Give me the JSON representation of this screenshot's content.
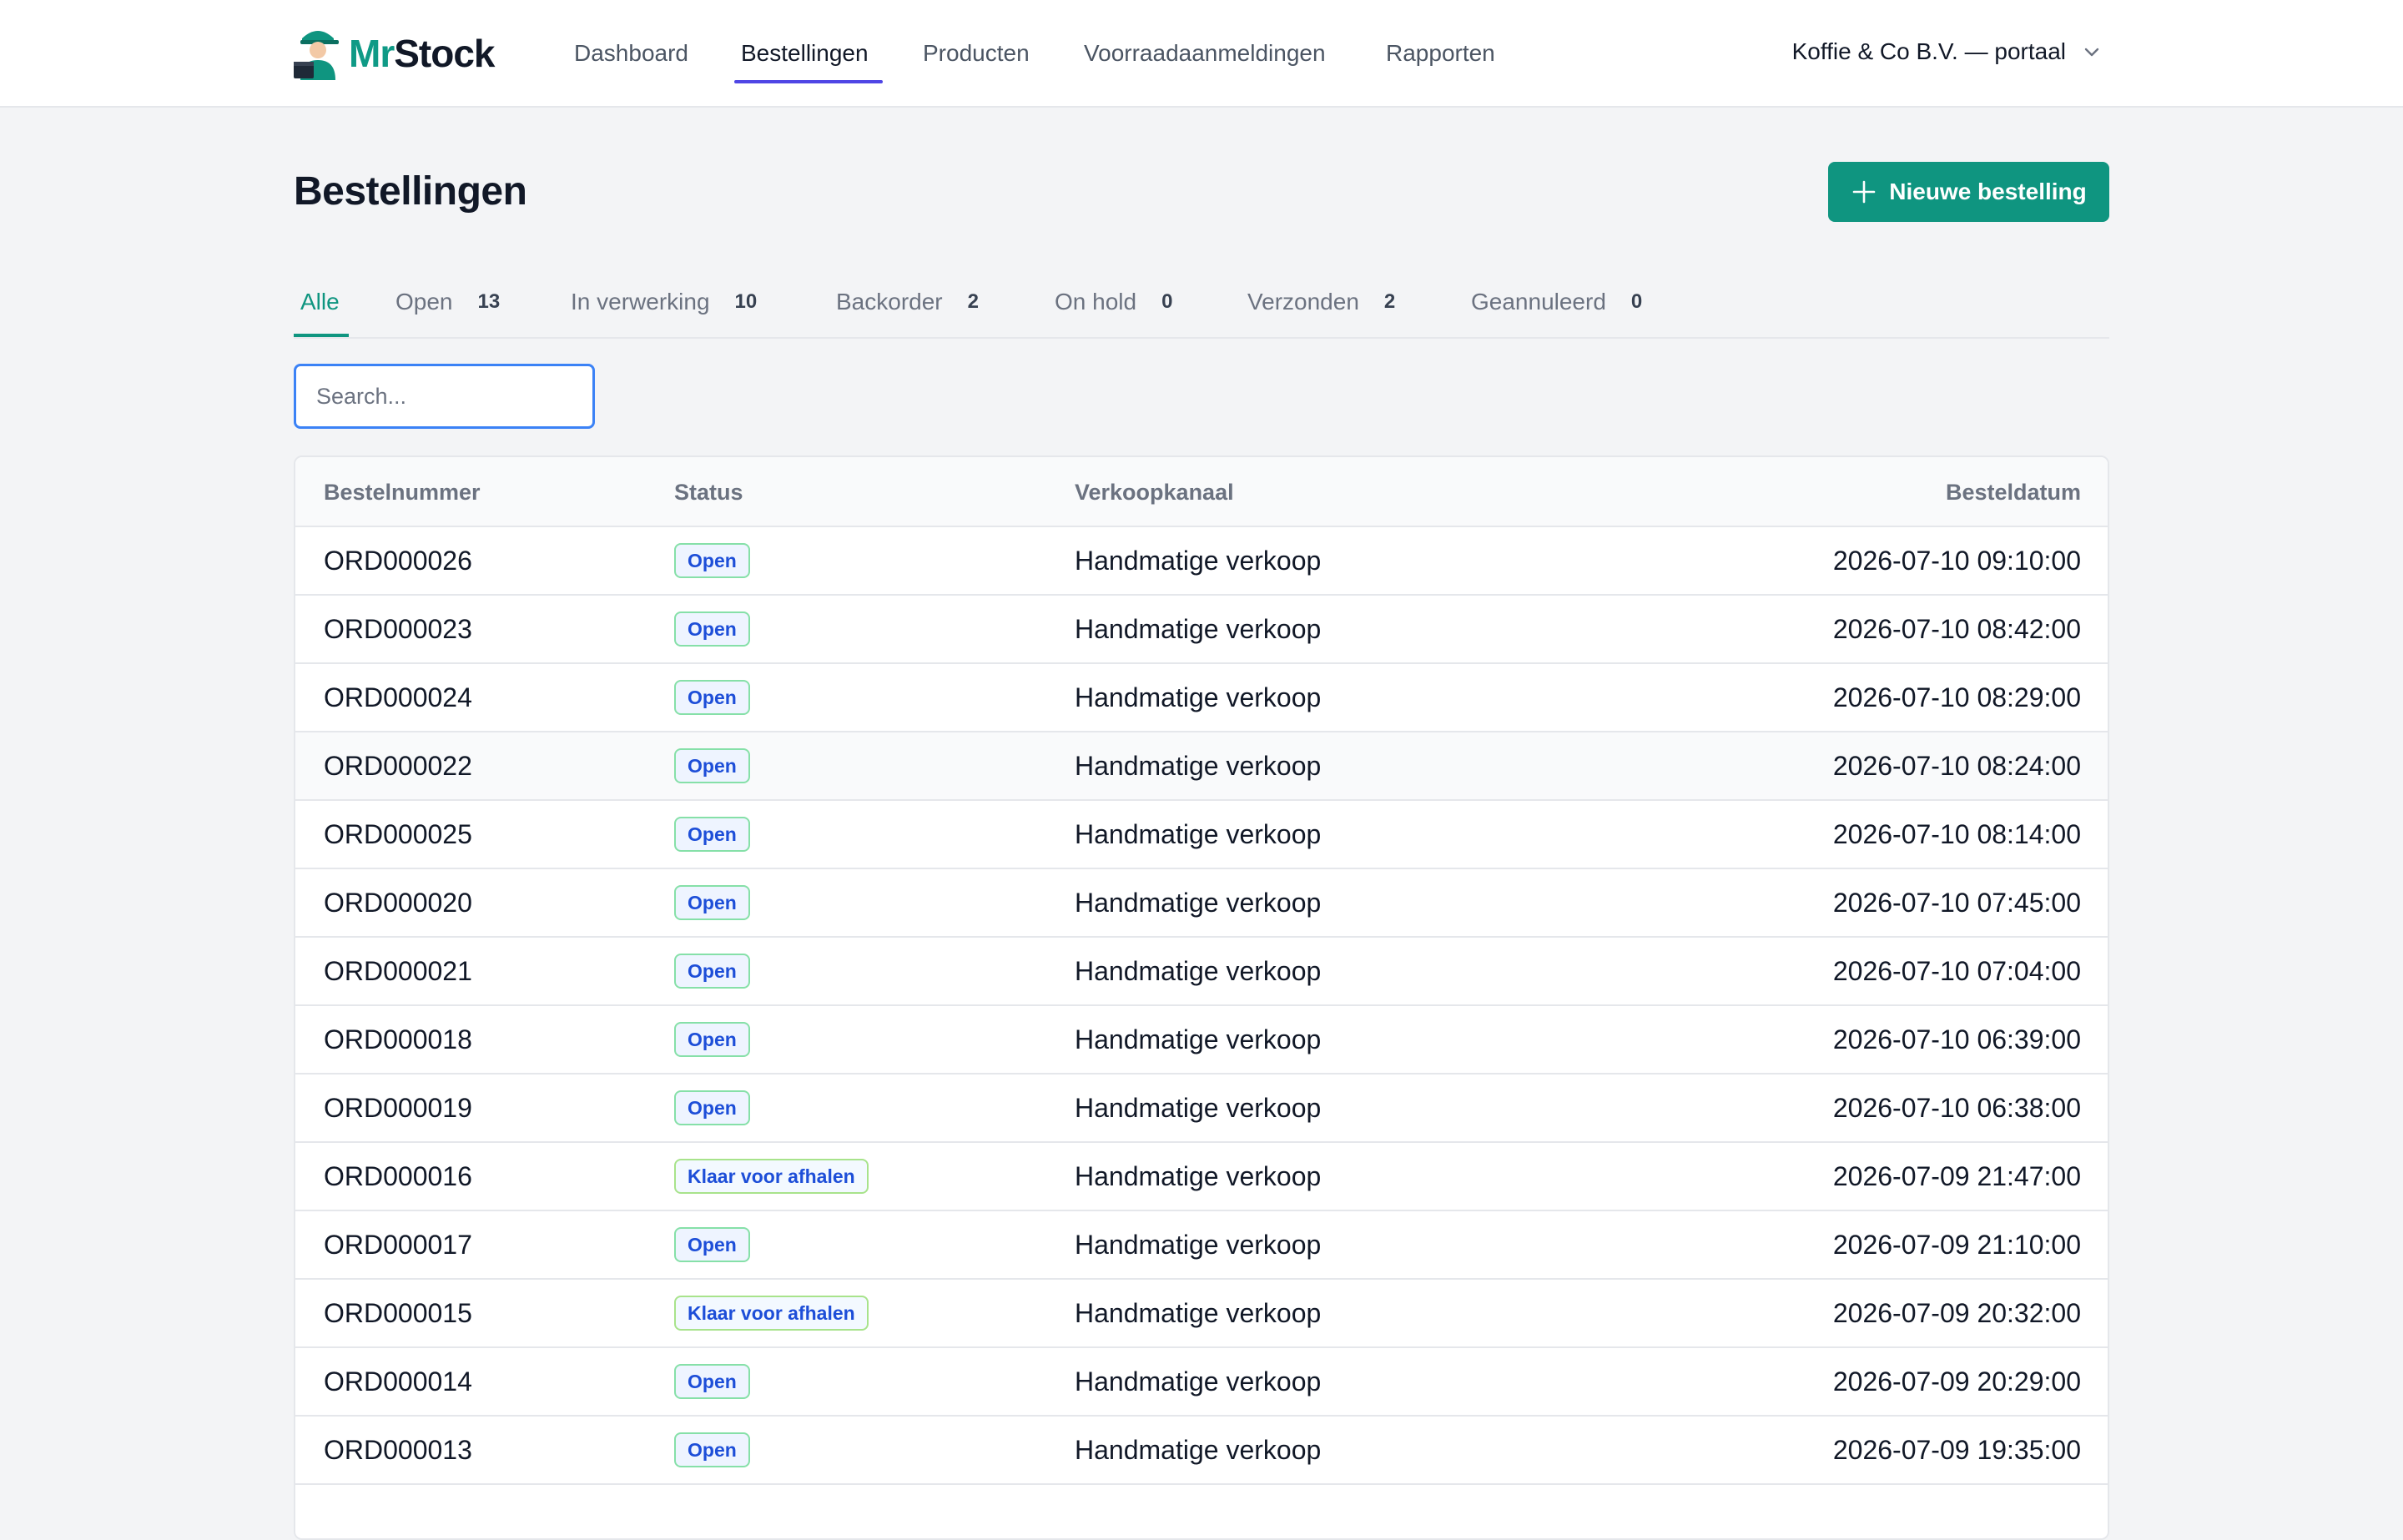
{
  "brand": {
    "mr": "Mr",
    "stock": "Stock",
    "mascot_icon": "delivery-person-icon"
  },
  "nav": [
    {
      "label": "Dashboard"
    },
    {
      "label": "Bestellingen"
    },
    {
      "label": "Producten"
    },
    {
      "label": "Voorraadaanmeldingen"
    },
    {
      "label": "Rapporten"
    }
  ],
  "nav_active": "Bestellingen",
  "account": {
    "label": "Koffie & Co B.V. — portaal",
    "icon": "chevron-down-icon"
  },
  "page": {
    "title": "Bestellingen",
    "new_button": "Nieuwe bestelling",
    "new_button_icon": "plus-icon",
    "accent_color": "#0f9580"
  },
  "tabs": [
    {
      "label": "Alle",
      "count": ""
    },
    {
      "label": "Open",
      "count": "13"
    },
    {
      "label": "In verwerking",
      "count": "10"
    },
    {
      "label": "Backorder",
      "count": "2"
    },
    {
      "label": "On hold",
      "count": "0"
    },
    {
      "label": "Verzonden",
      "count": "2"
    },
    {
      "label": "Geannuleerd",
      "count": "0"
    }
  ],
  "tab_active": "Alle",
  "search": {
    "placeholder": "Search...",
    "value": ""
  },
  "table": {
    "headers": [
      "Bestelnummer",
      "Status",
      "Verkoopkanaal",
      "Besteldatum"
    ],
    "rows": [
      {
        "order": "ORD000026",
        "status": "Open",
        "channel": "Handmatige verkoop",
        "date": "2026-07-10 09:10:00"
      },
      {
        "order": "ORD000023",
        "status": "Open",
        "channel": "Handmatige verkoop",
        "date": "2026-07-10 08:42:00"
      },
      {
        "order": "ORD000024",
        "status": "Open",
        "channel": "Handmatige verkoop",
        "date": "2026-07-10 08:29:00"
      },
      {
        "order": "ORD000022",
        "status": "Open",
        "channel": "Handmatige verkoop",
        "date": "2026-07-10 08:24:00"
      },
      {
        "order": "ORD000025",
        "status": "Open",
        "channel": "Handmatige verkoop",
        "date": "2026-07-10 08:14:00"
      },
      {
        "order": "ORD000020",
        "status": "Open",
        "channel": "Handmatige verkoop",
        "date": "2026-07-10 07:45:00"
      },
      {
        "order": "ORD000021",
        "status": "Open",
        "channel": "Handmatige verkoop",
        "date": "2026-07-10 07:04:00"
      },
      {
        "order": "ORD000018",
        "status": "Open",
        "channel": "Handmatige verkoop",
        "date": "2026-07-10 06:39:00"
      },
      {
        "order": "ORD000019",
        "status": "Open",
        "channel": "Handmatige verkoop",
        "date": "2026-07-10 06:38:00"
      },
      {
        "order": "ORD000016",
        "status": "Klaar voor afhalen",
        "channel": "Handmatige verkoop",
        "date": "2026-07-09 21:47:00"
      },
      {
        "order": "ORD000017",
        "status": "Open",
        "channel": "Handmatige verkoop",
        "date": "2026-07-09 21:10:00"
      },
      {
        "order": "ORD000015",
        "status": "Klaar voor afhalen",
        "channel": "Handmatige verkoop",
        "date": "2026-07-09 20:32:00"
      },
      {
        "order": "ORD000014",
        "status": "Open",
        "channel": "Handmatige verkoop",
        "date": "2026-07-09 20:29:00"
      },
      {
        "order": "ORD000013",
        "status": "Open",
        "channel": "Handmatige verkoop",
        "date": "2026-07-09 19:35:00"
      },
      {
        "order": "",
        "status": "",
        "channel": "",
        "date": ""
      }
    ]
  }
}
